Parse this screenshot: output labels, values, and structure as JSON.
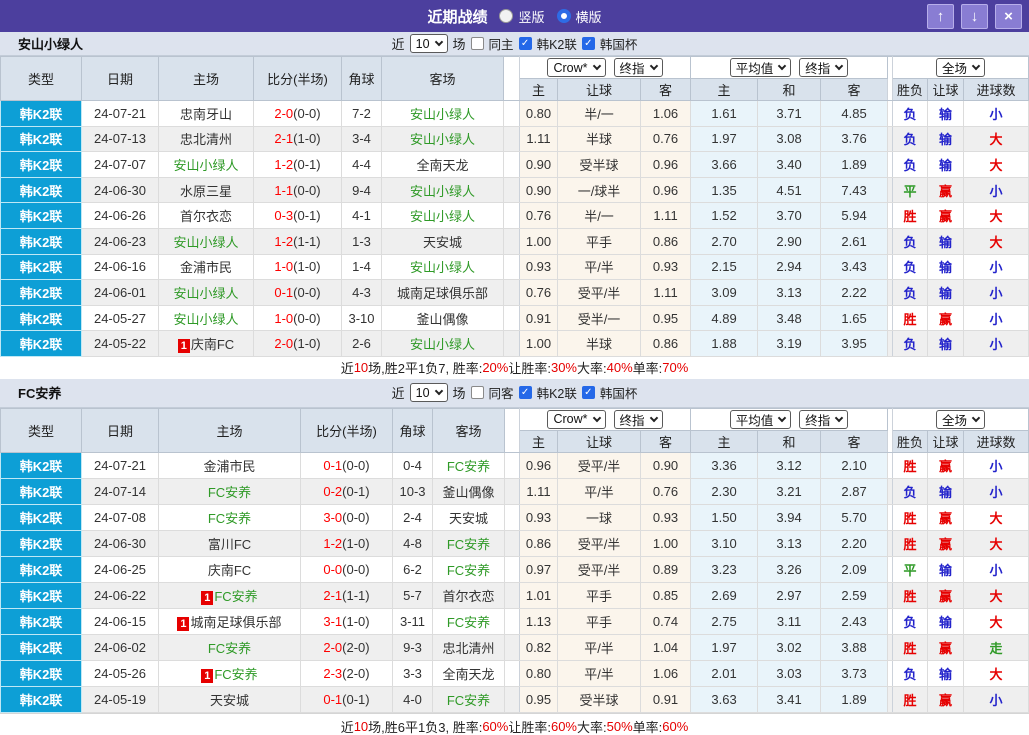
{
  "titlebar": {
    "title": "近期战绩",
    "radios": [
      {
        "label": "竖版",
        "checked": false
      },
      {
        "label": "横版",
        "checked": true
      }
    ],
    "buttons": {
      "up": "↑",
      "down": "↓",
      "close": "×"
    }
  },
  "columns": {
    "left": [
      "类型",
      "日期",
      "主场",
      "比分(半场)",
      "角球",
      "客场"
    ],
    "odds": [
      "主",
      "让球",
      "客"
    ],
    "avg": [
      "主",
      "和",
      "客"
    ],
    "result": [
      "胜负",
      "让球",
      "进球数"
    ]
  },
  "dropdowns": {
    "source": "Crow*",
    "source_type": "终指",
    "avg": "平均值",
    "avg_type": "终指",
    "scope": "全场"
  },
  "result_colors": {
    "胜": "red",
    "平": "green",
    "负": "blue",
    "赢": "red",
    "输": "blue",
    "大": "red",
    "小": "blue",
    "走": "green"
  },
  "accent_colors": {
    "red": "#e60000",
    "blue": "#2323cb",
    "green": "#2f9a27",
    "league_blue": "#0d9fd6",
    "bar_purple": "#4c3f9e"
  },
  "sections": [
    {
      "team": "安山小绿人",
      "filter": {
        "near": "近",
        "count": "10",
        "unit": "场",
        "same": {
          "label": "同主",
          "checked": false
        },
        "league": {
          "label": "韩K2联",
          "checked": true
        },
        "cup": {
          "label": "韩国杯",
          "checked": true
        }
      },
      "rows": [
        {
          "lg": "韩K2联",
          "date": "24-07-21",
          "home": {
            "t": "忠南牙山"
          },
          "score": {
            "ft": "2-0",
            "ht": "(0-0)"
          },
          "corner": "7-2",
          "away": {
            "t": "安山小绿人",
            "green": true
          },
          "odds": [
            "0.80",
            "半/一",
            "1.06"
          ],
          "avg": [
            "1.61",
            "3.71",
            "4.85"
          ],
          "res": [
            "负",
            "输",
            "小"
          ]
        },
        {
          "lg": "韩K2联",
          "date": "24-07-13",
          "home": {
            "t": "忠北清州"
          },
          "score": {
            "ft": "2-1",
            "ht": "(1-0)"
          },
          "corner": "3-4",
          "away": {
            "t": "安山小绿人",
            "green": true
          },
          "odds": [
            "1.11",
            "半球",
            "0.76"
          ],
          "avg": [
            "1.97",
            "3.08",
            "3.76"
          ],
          "res": [
            "负",
            "输",
            "大"
          ]
        },
        {
          "lg": "韩K2联",
          "date": "24-07-07",
          "home": {
            "t": "安山小绿人",
            "green": true
          },
          "score": {
            "ft": "1-2",
            "ht": "(0-1)"
          },
          "corner": "4-4",
          "away": {
            "t": "全南天龙"
          },
          "odds": [
            "0.90",
            "受半球",
            "0.96"
          ],
          "avg": [
            "3.66",
            "3.40",
            "1.89"
          ],
          "res": [
            "负",
            "输",
            "大"
          ]
        },
        {
          "lg": "韩K2联",
          "date": "24-06-30",
          "home": {
            "t": "水原三星"
          },
          "score": {
            "ft": "1-1",
            "ht": "(0-0)"
          },
          "corner": "9-4",
          "away": {
            "t": "安山小绿人",
            "green": true
          },
          "odds": [
            "0.90",
            "一/球半",
            "0.96"
          ],
          "avg": [
            "1.35",
            "4.51",
            "7.43"
          ],
          "res": [
            "平",
            "赢",
            "小"
          ]
        },
        {
          "lg": "韩K2联",
          "date": "24-06-26",
          "home": {
            "t": "首尔衣恋"
          },
          "score": {
            "ft": "0-3",
            "ht": "(0-1)"
          },
          "corner": "4-1",
          "away": {
            "t": "安山小绿人",
            "green": true
          },
          "odds": [
            "0.76",
            "半/一",
            "1.11"
          ],
          "avg": [
            "1.52",
            "3.70",
            "5.94"
          ],
          "res": [
            "胜",
            "赢",
            "大"
          ]
        },
        {
          "lg": "韩K2联",
          "date": "24-06-23",
          "home": {
            "t": "安山小绿人",
            "green": true
          },
          "score": {
            "ft": "1-2",
            "ht": "(1-1)"
          },
          "corner": "1-3",
          "away": {
            "t": "天安城"
          },
          "odds": [
            "1.00",
            "平手",
            "0.86"
          ],
          "avg": [
            "2.70",
            "2.90",
            "2.61"
          ],
          "res": [
            "负",
            "输",
            "大"
          ]
        },
        {
          "lg": "韩K2联",
          "date": "24-06-16",
          "home": {
            "t": "金浦市民"
          },
          "score": {
            "ft": "1-0",
            "ht": "(1-0)"
          },
          "corner": "1-4",
          "away": {
            "t": "安山小绿人",
            "green": true
          },
          "odds": [
            "0.93",
            "平/半",
            "0.93"
          ],
          "avg": [
            "2.15",
            "2.94",
            "3.43"
          ],
          "res": [
            "负",
            "输",
            "小"
          ]
        },
        {
          "lg": "韩K2联",
          "date": "24-06-01",
          "home": {
            "t": "安山小绿人",
            "green": true
          },
          "score": {
            "ft": "0-1",
            "ht": "(0-0)"
          },
          "corner": "4-3",
          "away": {
            "t": "城南足球俱乐部"
          },
          "odds": [
            "0.76",
            "受平/半",
            "1.11"
          ],
          "avg": [
            "3.09",
            "3.13",
            "2.22"
          ],
          "res": [
            "负",
            "输",
            "小"
          ]
        },
        {
          "lg": "韩K2联",
          "date": "24-05-27",
          "home": {
            "t": "安山小绿人",
            "green": true
          },
          "score": {
            "ft": "1-0",
            "ht": "(0-0)"
          },
          "corner": "3-10",
          "away": {
            "t": "釜山偶像"
          },
          "odds": [
            "0.91",
            "受半/一",
            "0.95"
          ],
          "avg": [
            "4.89",
            "3.48",
            "1.65"
          ],
          "res": [
            "胜",
            "赢",
            "小"
          ]
        },
        {
          "lg": "韩K2联",
          "date": "24-05-22",
          "home": {
            "t": "庆南FC",
            "badge": "1"
          },
          "score": {
            "ft": "2-0",
            "ht": "(1-0)"
          },
          "corner": "2-6",
          "away": {
            "t": "安山小绿人",
            "green": true
          },
          "odds": [
            "1.00",
            "半球",
            "0.86"
          ],
          "avg": [
            "1.88",
            "3.19",
            "3.95"
          ],
          "res": [
            "负",
            "输",
            "小"
          ]
        }
      ],
      "summary": [
        {
          "t": "近"
        },
        {
          "t": "10",
          "red": true
        },
        {
          "t": "场,胜2平1负7, 胜率:"
        },
        {
          "t": "20%",
          "red": true
        },
        {
          "t": " 让胜率:"
        },
        {
          "t": "30%",
          "red": true
        },
        {
          "t": " 大率:"
        },
        {
          "t": "40%",
          "red": true
        },
        {
          "t": " 单率:"
        },
        {
          "t": "70%",
          "red": true
        }
      ]
    },
    {
      "team": "FC安养",
      "filter": {
        "near": "近",
        "count": "10",
        "unit": "场",
        "same": {
          "label": "同客",
          "checked": false
        },
        "league": {
          "label": "韩K2联",
          "checked": true
        },
        "cup": {
          "label": "韩国杯",
          "checked": true
        }
      },
      "rows": [
        {
          "lg": "韩K2联",
          "date": "24-07-21",
          "home": {
            "t": "金浦市民"
          },
          "score": {
            "ft": "0-1",
            "ht": "(0-0)"
          },
          "corner": "0-4",
          "away": {
            "t": "FC安养",
            "green": true
          },
          "odds": [
            "0.96",
            "受平/半",
            "0.90"
          ],
          "avg": [
            "3.36",
            "3.12",
            "2.10"
          ],
          "res": [
            "胜",
            "赢",
            "小"
          ]
        },
        {
          "lg": "韩K2联",
          "date": "24-07-14",
          "home": {
            "t": "FC安养",
            "green": true
          },
          "score": {
            "ft": "0-2",
            "ht": "(0-1)"
          },
          "corner": "10-3",
          "away": {
            "t": "釜山偶像"
          },
          "odds": [
            "1.11",
            "平/半",
            "0.76"
          ],
          "avg": [
            "2.30",
            "3.21",
            "2.87"
          ],
          "res": [
            "负",
            "输",
            "小"
          ]
        },
        {
          "lg": "韩K2联",
          "date": "24-07-08",
          "home": {
            "t": "FC安养",
            "green": true
          },
          "score": {
            "ft": "3-0",
            "ht": "(0-0)"
          },
          "corner": "2-4",
          "away": {
            "t": "天安城"
          },
          "odds": [
            "0.93",
            "一球",
            "0.93"
          ],
          "avg": [
            "1.50",
            "3.94",
            "5.70"
          ],
          "res": [
            "胜",
            "赢",
            "大"
          ]
        },
        {
          "lg": "韩K2联",
          "date": "24-06-30",
          "home": {
            "t": "富川FC"
          },
          "score": {
            "ft": "1-2",
            "ht": "(1-0)"
          },
          "corner": "4-8",
          "away": {
            "t": "FC安养",
            "green": true
          },
          "odds": [
            "0.86",
            "受平/半",
            "1.00"
          ],
          "avg": [
            "3.10",
            "3.13",
            "2.20"
          ],
          "res": [
            "胜",
            "赢",
            "大"
          ]
        },
        {
          "lg": "韩K2联",
          "date": "24-06-25",
          "home": {
            "t": "庆南FC"
          },
          "score": {
            "ft": "0-0",
            "ht": "(0-0)"
          },
          "corner": "6-2",
          "away": {
            "t": "FC安养",
            "green": true
          },
          "odds": [
            "0.97",
            "受平/半",
            "0.89"
          ],
          "avg": [
            "3.23",
            "3.26",
            "2.09"
          ],
          "res": [
            "平",
            "输",
            "小"
          ]
        },
        {
          "lg": "韩K2联",
          "date": "24-06-22",
          "home": {
            "t": "FC安养",
            "green": true,
            "badge": "1"
          },
          "score": {
            "ft": "2-1",
            "ht": "(1-1)"
          },
          "corner": "5-7",
          "away": {
            "t": "首尔衣恋"
          },
          "odds": [
            "1.01",
            "平手",
            "0.85"
          ],
          "avg": [
            "2.69",
            "2.97",
            "2.59"
          ],
          "res": [
            "胜",
            "赢",
            "大"
          ]
        },
        {
          "lg": "韩K2联",
          "date": "24-06-15",
          "home": {
            "t": "城南足球俱乐部",
            "badge": "1"
          },
          "score": {
            "ft": "3-1",
            "ht": "(1-0)"
          },
          "corner": "3-11",
          "away": {
            "t": "FC安养",
            "green": true
          },
          "odds": [
            "1.13",
            "平手",
            "0.74"
          ],
          "avg": [
            "2.75",
            "3.11",
            "2.43"
          ],
          "res": [
            "负",
            "输",
            "大"
          ]
        },
        {
          "lg": "韩K2联",
          "date": "24-06-02",
          "home": {
            "t": "FC安养",
            "green": true
          },
          "score": {
            "ft": "2-0",
            "ht": "(2-0)"
          },
          "corner": "9-3",
          "away": {
            "t": "忠北清州"
          },
          "odds": [
            "0.82",
            "平/半",
            "1.04"
          ],
          "avg": [
            "1.97",
            "3.02",
            "3.88"
          ],
          "res": [
            "胜",
            "赢",
            "走"
          ]
        },
        {
          "lg": "韩K2联",
          "date": "24-05-26",
          "home": {
            "t": "FC安养",
            "green": true,
            "badge": "1"
          },
          "score": {
            "ft": "2-3",
            "ht": "(2-0)"
          },
          "corner": "3-3",
          "away": {
            "t": "全南天龙"
          },
          "odds": [
            "0.80",
            "平/半",
            "1.06"
          ],
          "avg": [
            "2.01",
            "3.03",
            "3.73"
          ],
          "res": [
            "负",
            "输",
            "大"
          ]
        },
        {
          "lg": "韩K2联",
          "date": "24-05-19",
          "home": {
            "t": "天安城"
          },
          "score": {
            "ft": "0-1",
            "ht": "(0-1)"
          },
          "corner": "4-0",
          "away": {
            "t": "FC安养",
            "green": true
          },
          "odds": [
            "0.95",
            "受半球",
            "0.91"
          ],
          "avg": [
            "3.63",
            "3.41",
            "1.89"
          ],
          "res": [
            "胜",
            "赢",
            "小"
          ]
        }
      ],
      "summary": [
        {
          "t": "近"
        },
        {
          "t": "10",
          "red": true
        },
        {
          "t": "场,胜6平1负3, 胜率:"
        },
        {
          "t": "60%",
          "red": true
        },
        {
          "t": " 让胜率:"
        },
        {
          "t": "60%",
          "red": true
        },
        {
          "t": " 大率:"
        },
        {
          "t": "50%",
          "red": true
        },
        {
          "t": " 单率:"
        },
        {
          "t": "60%",
          "red": true
        }
      ]
    }
  ]
}
